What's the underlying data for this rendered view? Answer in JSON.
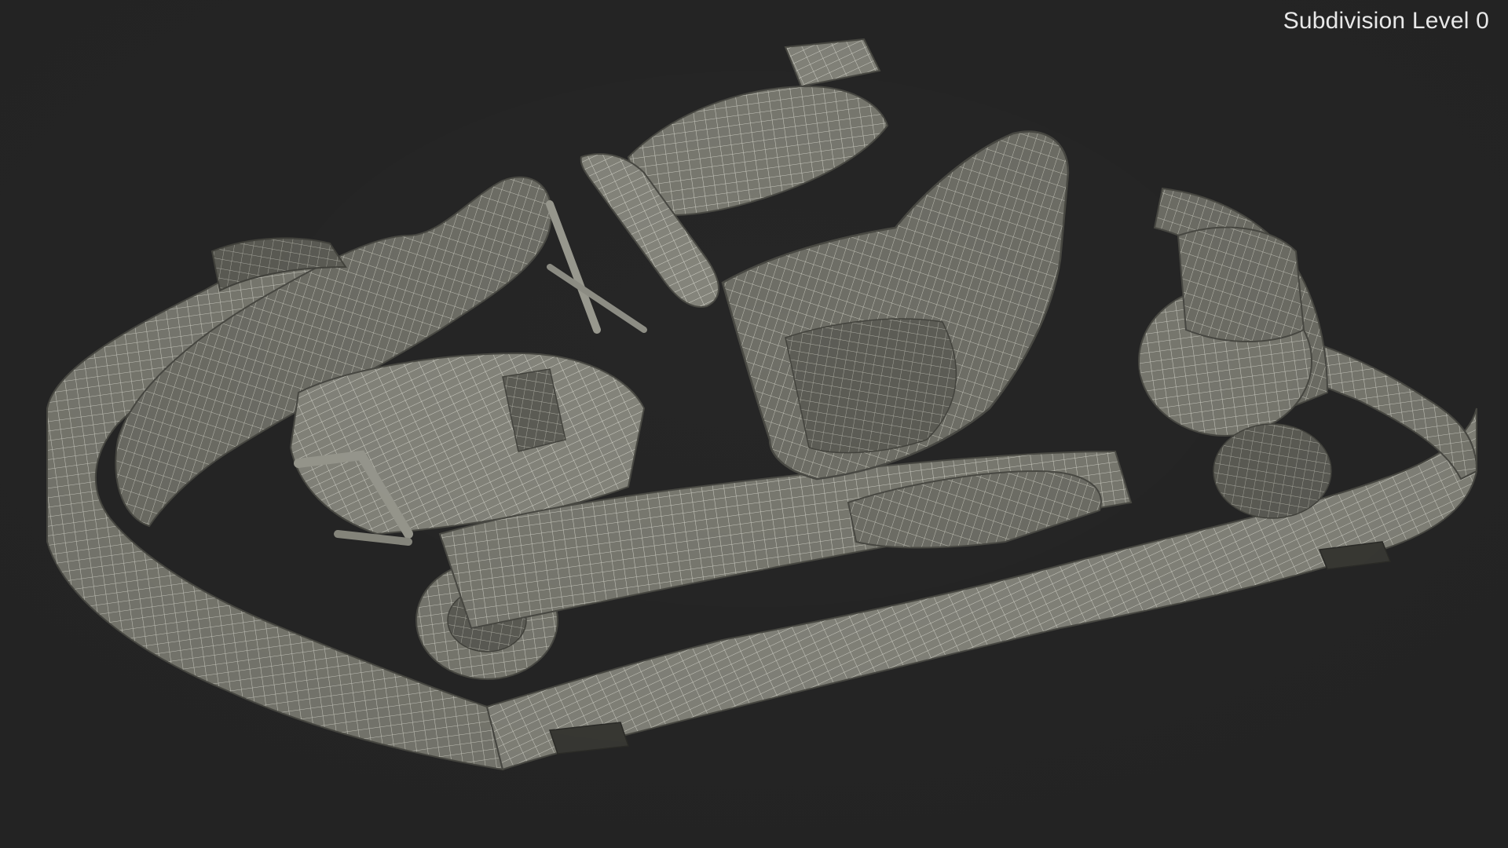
{
  "viewport": {
    "overlay_label": "Subdivision Level 0",
    "background_color": "#262626",
    "model_color": "#7b7b72",
    "wire_color": "#e4e4da"
  }
}
